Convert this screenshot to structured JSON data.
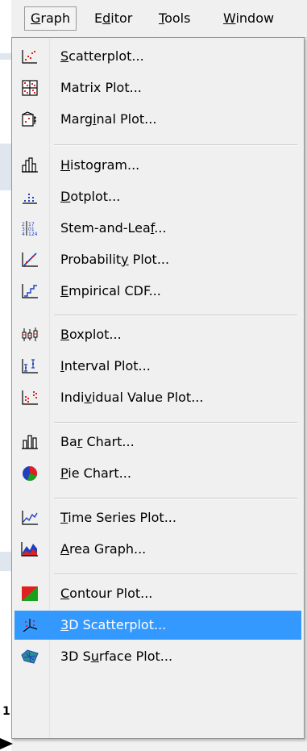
{
  "menubar": {
    "items": [
      {
        "text": "Graph",
        "mnemonic": "G"
      },
      {
        "text": "Editor",
        "mnemonic": "d"
      },
      {
        "text": "Tools",
        "mnemonic": "T"
      },
      {
        "text": "Window",
        "mnemonic": "W"
      }
    ]
  },
  "graph_menu": {
    "items": [
      {
        "text": "Scatterplot...",
        "mnemonic": "S",
        "icon": "scatterplot-icon"
      },
      {
        "text": "Matrix Plot...",
        "mnemonic": "",
        "icon": "matrix-plot-icon"
      },
      {
        "text": "Marginal Plot...",
        "mnemonic": "i",
        "icon": "marginal-plot-icon"
      },
      {
        "text": "Histogram...",
        "mnemonic": "H",
        "icon": "histogram-icon"
      },
      {
        "text": "Dotplot...",
        "mnemonic": "D",
        "icon": "dotplot-icon"
      },
      {
        "text": "Stem-and-Leaf...",
        "mnemonic": "f",
        "icon": "stem-and-leaf-icon"
      },
      {
        "text": "Probability Plot...",
        "mnemonic": "y",
        "icon": "probability-plot-icon"
      },
      {
        "text": "Empirical CDF...",
        "mnemonic": "E",
        "icon": "empirical-cdf-icon"
      },
      {
        "text": "Boxplot...",
        "mnemonic": "B",
        "icon": "boxplot-icon"
      },
      {
        "text": "Interval Plot...",
        "mnemonic": "I",
        "icon": "interval-plot-icon"
      },
      {
        "text": "Individual Value Plot...",
        "mnemonic": "v",
        "icon": "individual-value-plot-icon"
      },
      {
        "text": "Bar Chart...",
        "mnemonic": "r",
        "icon": "bar-chart-icon"
      },
      {
        "text": "Pie Chart...",
        "mnemonic": "P",
        "icon": "pie-chart-icon"
      },
      {
        "text": "Time Series Plot...",
        "mnemonic": "T",
        "icon": "time-series-plot-icon"
      },
      {
        "text": "Area Graph...",
        "mnemonic": "A",
        "icon": "area-graph-icon"
      },
      {
        "text": "Contour Plot...",
        "mnemonic": "C",
        "icon": "contour-plot-icon"
      },
      {
        "text": "3D Scatterplot...",
        "mnemonic": "3",
        "icon": "3d-scatterplot-icon",
        "highlighted": true
      },
      {
        "text": "3D Surface Plot...",
        "mnemonic": "u",
        "icon": "3d-surface-plot-icon"
      }
    ]
  },
  "background": {
    "fragments": [
      "1"
    ]
  },
  "colors": {
    "highlight": "#3399ff",
    "menu_bg": "#f0f0f0",
    "accent_red": "#e02020",
    "accent_blue": "#1f3fbf",
    "accent_green": "#1aa01a"
  }
}
